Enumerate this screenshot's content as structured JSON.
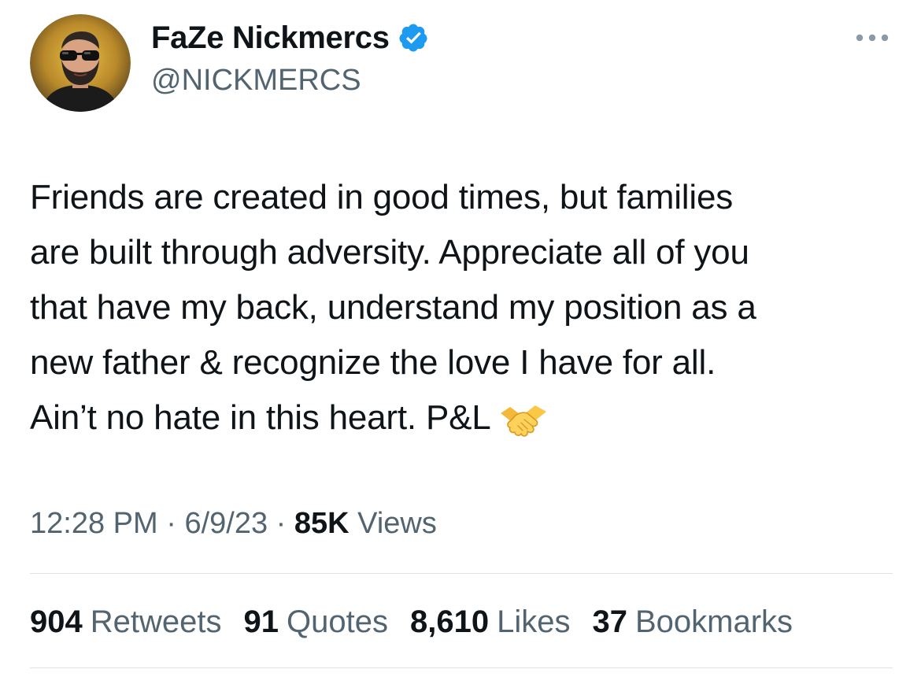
{
  "author": {
    "display_name": "FaZe Nickmercs",
    "handle": "@NICKMERCS",
    "verified": true,
    "verified_badge_color": "#1d9bf0"
  },
  "tweet": {
    "lines": [
      "Friends are created in good times, but families",
      "are built through adversity. Appreciate all of you",
      "that have my back, understand my position as a",
      "new father & recognize the love I have for all.",
      "Ain’t no hate in this heart. P&L"
    ],
    "emoji": "handshake-emoji"
  },
  "meta": {
    "time": "12:28 PM",
    "separator": "·",
    "date": "6/9/23",
    "views_count": "85K",
    "views_label": "Views"
  },
  "stats": [
    {
      "count": "904",
      "label": "Retweets"
    },
    {
      "count": "91",
      "label": "Quotes"
    },
    {
      "count": "8,610",
      "label": "Likes"
    },
    {
      "count": "37",
      "label": "Bookmarks"
    }
  ],
  "icons": {
    "avatar": "profile-avatar",
    "badge": "verified-badge-icon",
    "more": "more-options-icon"
  },
  "colors": {
    "text_primary": "#0f1419",
    "text_secondary": "#536471",
    "divider": "#dfe3e6",
    "accent": "#1d9bf0"
  }
}
